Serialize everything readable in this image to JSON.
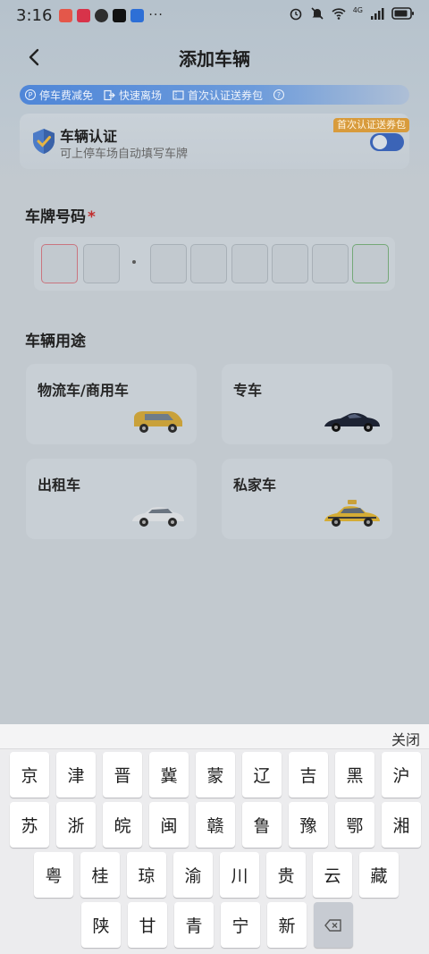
{
  "status_bar": {
    "time": "3:16",
    "network": "4G"
  },
  "header": {
    "title": "添加车辆"
  },
  "promo_bar": {
    "items": [
      "停车费减免",
      "快速离场",
      "首次认证送券包"
    ],
    "icons": [
      "parking-icon",
      "exit-icon",
      "coupon-icon",
      "help-icon"
    ]
  },
  "auth_card": {
    "title": "车辆认证",
    "subtitle": "可上停车场自动填写车牌",
    "badge": "首次认证送券包",
    "toggle_on": true
  },
  "plate_section": {
    "title": "车牌号码",
    "required_mark": "*"
  },
  "usage_section": {
    "title": "车辆用途",
    "options": [
      "物流车/商用车",
      "专车",
      "出租车",
      "私家车"
    ]
  },
  "keyboard": {
    "close_label": "关闭",
    "rows": [
      [
        "京",
        "津",
        "晋",
        "冀",
        "蒙",
        "辽",
        "吉",
        "黑",
        "沪"
      ],
      [
        "苏",
        "浙",
        "皖",
        "闽",
        "赣",
        "鲁",
        "豫",
        "鄂",
        "湘"
      ],
      [
        "粤",
        "桂",
        "琼",
        "渝",
        "川",
        "贵",
        "云",
        "藏"
      ],
      [
        "陕",
        "甘",
        "青",
        "宁",
        "新"
      ]
    ],
    "delete_icon": "backspace-icon"
  },
  "colors": {
    "accent": "#3b64b7",
    "required": "#c12d2d",
    "badge": "#d89b3c",
    "plate_active_border": "#c9757f",
    "plate_ev_border": "#74a878"
  }
}
